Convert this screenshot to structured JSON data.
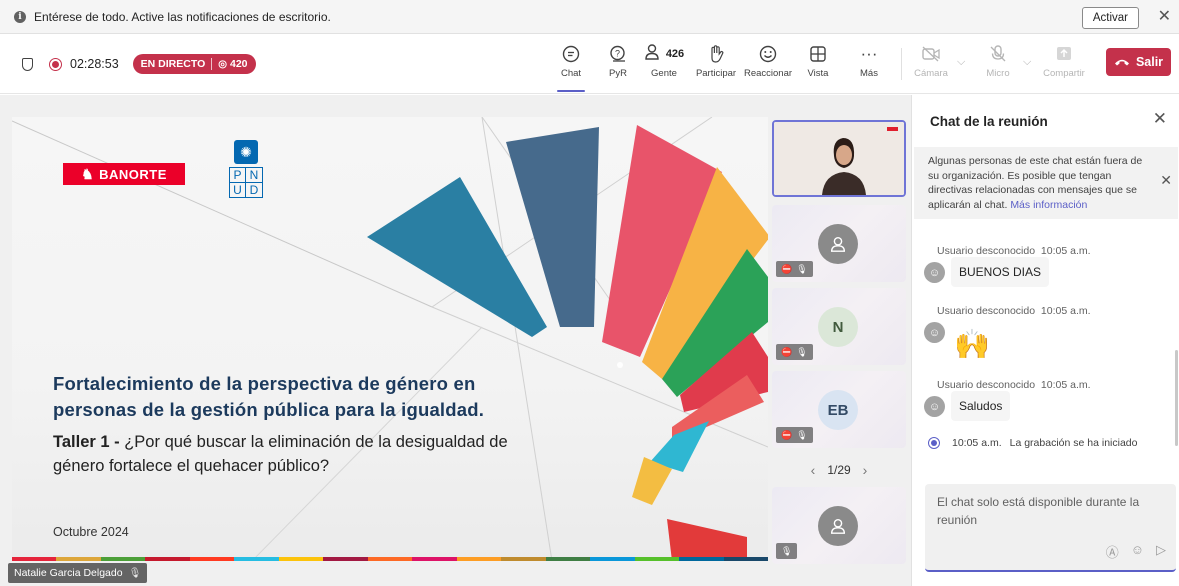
{
  "notification": {
    "text": "Entérese de todo. Active las notificaciones de escritorio.",
    "activate_label": "Activar",
    "close_glyph": "✕"
  },
  "meeting": {
    "timer": "02:28:53",
    "live_label": "EN DIRECTO",
    "viewer_count": "420"
  },
  "toolbar": {
    "chat": "Chat",
    "qa": "PyR",
    "people": "Gente",
    "people_count": "426",
    "raise": "Participar",
    "react": "Reaccionar",
    "view": "Vista",
    "more": "Más",
    "camera": "Cámara",
    "mic": "Micro",
    "share": "Compartir",
    "leave": "Salir"
  },
  "slide": {
    "brand": "BANORTE",
    "pnud_letters": [
      "P",
      "N",
      "U",
      "D"
    ],
    "title": "Fortalecimiento de la perspectiva de género en personas de la gestión pública para la igualdad.",
    "subtitle_bold": "Taller 1 -",
    "subtitle_rest": " ¿Por qué buscar la eliminación de la desigualdad de género fortalece el quehacer público?",
    "date": "Octubre 2024",
    "presenter": "Natalie Garcia Delgado"
  },
  "tiles": [
    {
      "type": "video"
    },
    {
      "type": "avatar",
      "initials": ""
    },
    {
      "type": "avatar",
      "initials": "N"
    },
    {
      "type": "avatar",
      "initials": "EB"
    },
    {
      "type": "avatar",
      "initials": ""
    }
  ],
  "pager": "1/29",
  "chat": {
    "title": "Chat de la reunión",
    "warning": "Algunas personas de este chat están fuera de su organización. Es posible que tengan directivas relacionadas con mensajes que se aplicarán al chat.",
    "warning_link": "Más información",
    "messages": [
      {
        "author": "Usuario desconocido",
        "time": "10:05 a.m.",
        "text": "BUENOS DIAS"
      },
      {
        "author": "Usuario desconocido",
        "time": "10:05 a.m.",
        "text": "🙌"
      },
      {
        "author": "Usuario desconocido",
        "time": "10:05 a.m.",
        "text": "Saludos"
      }
    ],
    "system_time": "10:05 a.m.",
    "system_text": "La grabación se ha iniciado",
    "compose_placeholder": "El chat solo está disponible durante la reunión"
  },
  "colors": {
    "accent": "#5b5fc7",
    "leave": "#c4314b",
    "live": "#c4314b",
    "banorte": "#eb0029",
    "pnud": "#0468b1",
    "title": "#1c3a5d"
  }
}
